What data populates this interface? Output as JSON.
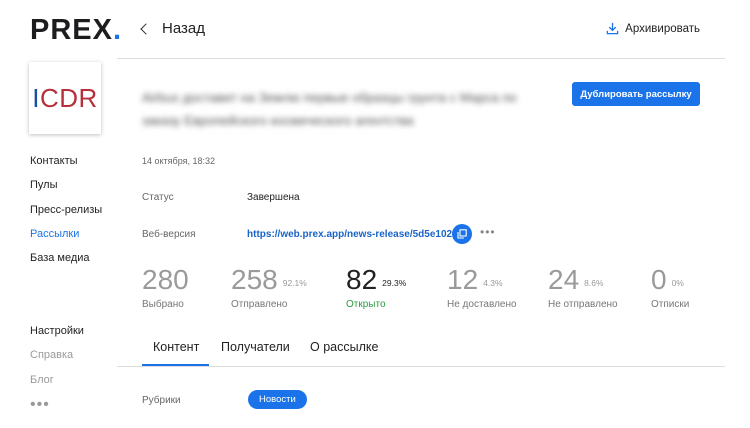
{
  "brand": {
    "name": "PREX",
    "dot": "."
  },
  "company_logo": {
    "text": "CDR"
  },
  "sidebar": {
    "items": [
      {
        "label": "Контакты"
      },
      {
        "label": "Пулы"
      },
      {
        "label": "Пресс-релизы"
      },
      {
        "label": "Рассылки"
      },
      {
        "label": "База медиа"
      }
    ],
    "bottom_items": [
      {
        "label": "Настройки"
      },
      {
        "label": "Справка"
      },
      {
        "label": "Блог"
      }
    ],
    "more": "•••"
  },
  "header": {
    "back_label": "Назад",
    "archive_label": "Архивировать"
  },
  "release": {
    "title": "Airbus доставит на Землю первые образцы грунта с Марса по заказу Европейского космического агентства",
    "date": "14 октября, 18:32",
    "duplicate_button": "Дублировать рассылку"
  },
  "info": {
    "status_label": "Статус",
    "status_value": "Завершена",
    "web_label": "Веб-версия",
    "web_url": "https://web.prex.app/news-release/5d5e1027",
    "more": "•••"
  },
  "stats": [
    {
      "value": "280",
      "percent": "",
      "label": "Выбрано"
    },
    {
      "value": "258",
      "percent": "92.1%",
      "label": "Отправлено"
    },
    {
      "value": "82",
      "percent": "29.3%",
      "label": "Открыто"
    },
    {
      "value": "12",
      "percent": "4.3%",
      "label": "Не доставлено"
    },
    {
      "value": "24",
      "percent": "8.6%",
      "label": "Не отправлено"
    },
    {
      "value": "0",
      "percent": "0%",
      "label": "Отписки"
    }
  ],
  "tabs": [
    {
      "label": "Контент"
    },
    {
      "label": "Получатели"
    },
    {
      "label": "О рассылке"
    }
  ],
  "rubric": {
    "label": "Рубрики",
    "tag": "Новости"
  },
  "colors": {
    "accent": "#1a73e8",
    "opened": "#2e9b3e",
    "logo_red": "#b5303a"
  }
}
